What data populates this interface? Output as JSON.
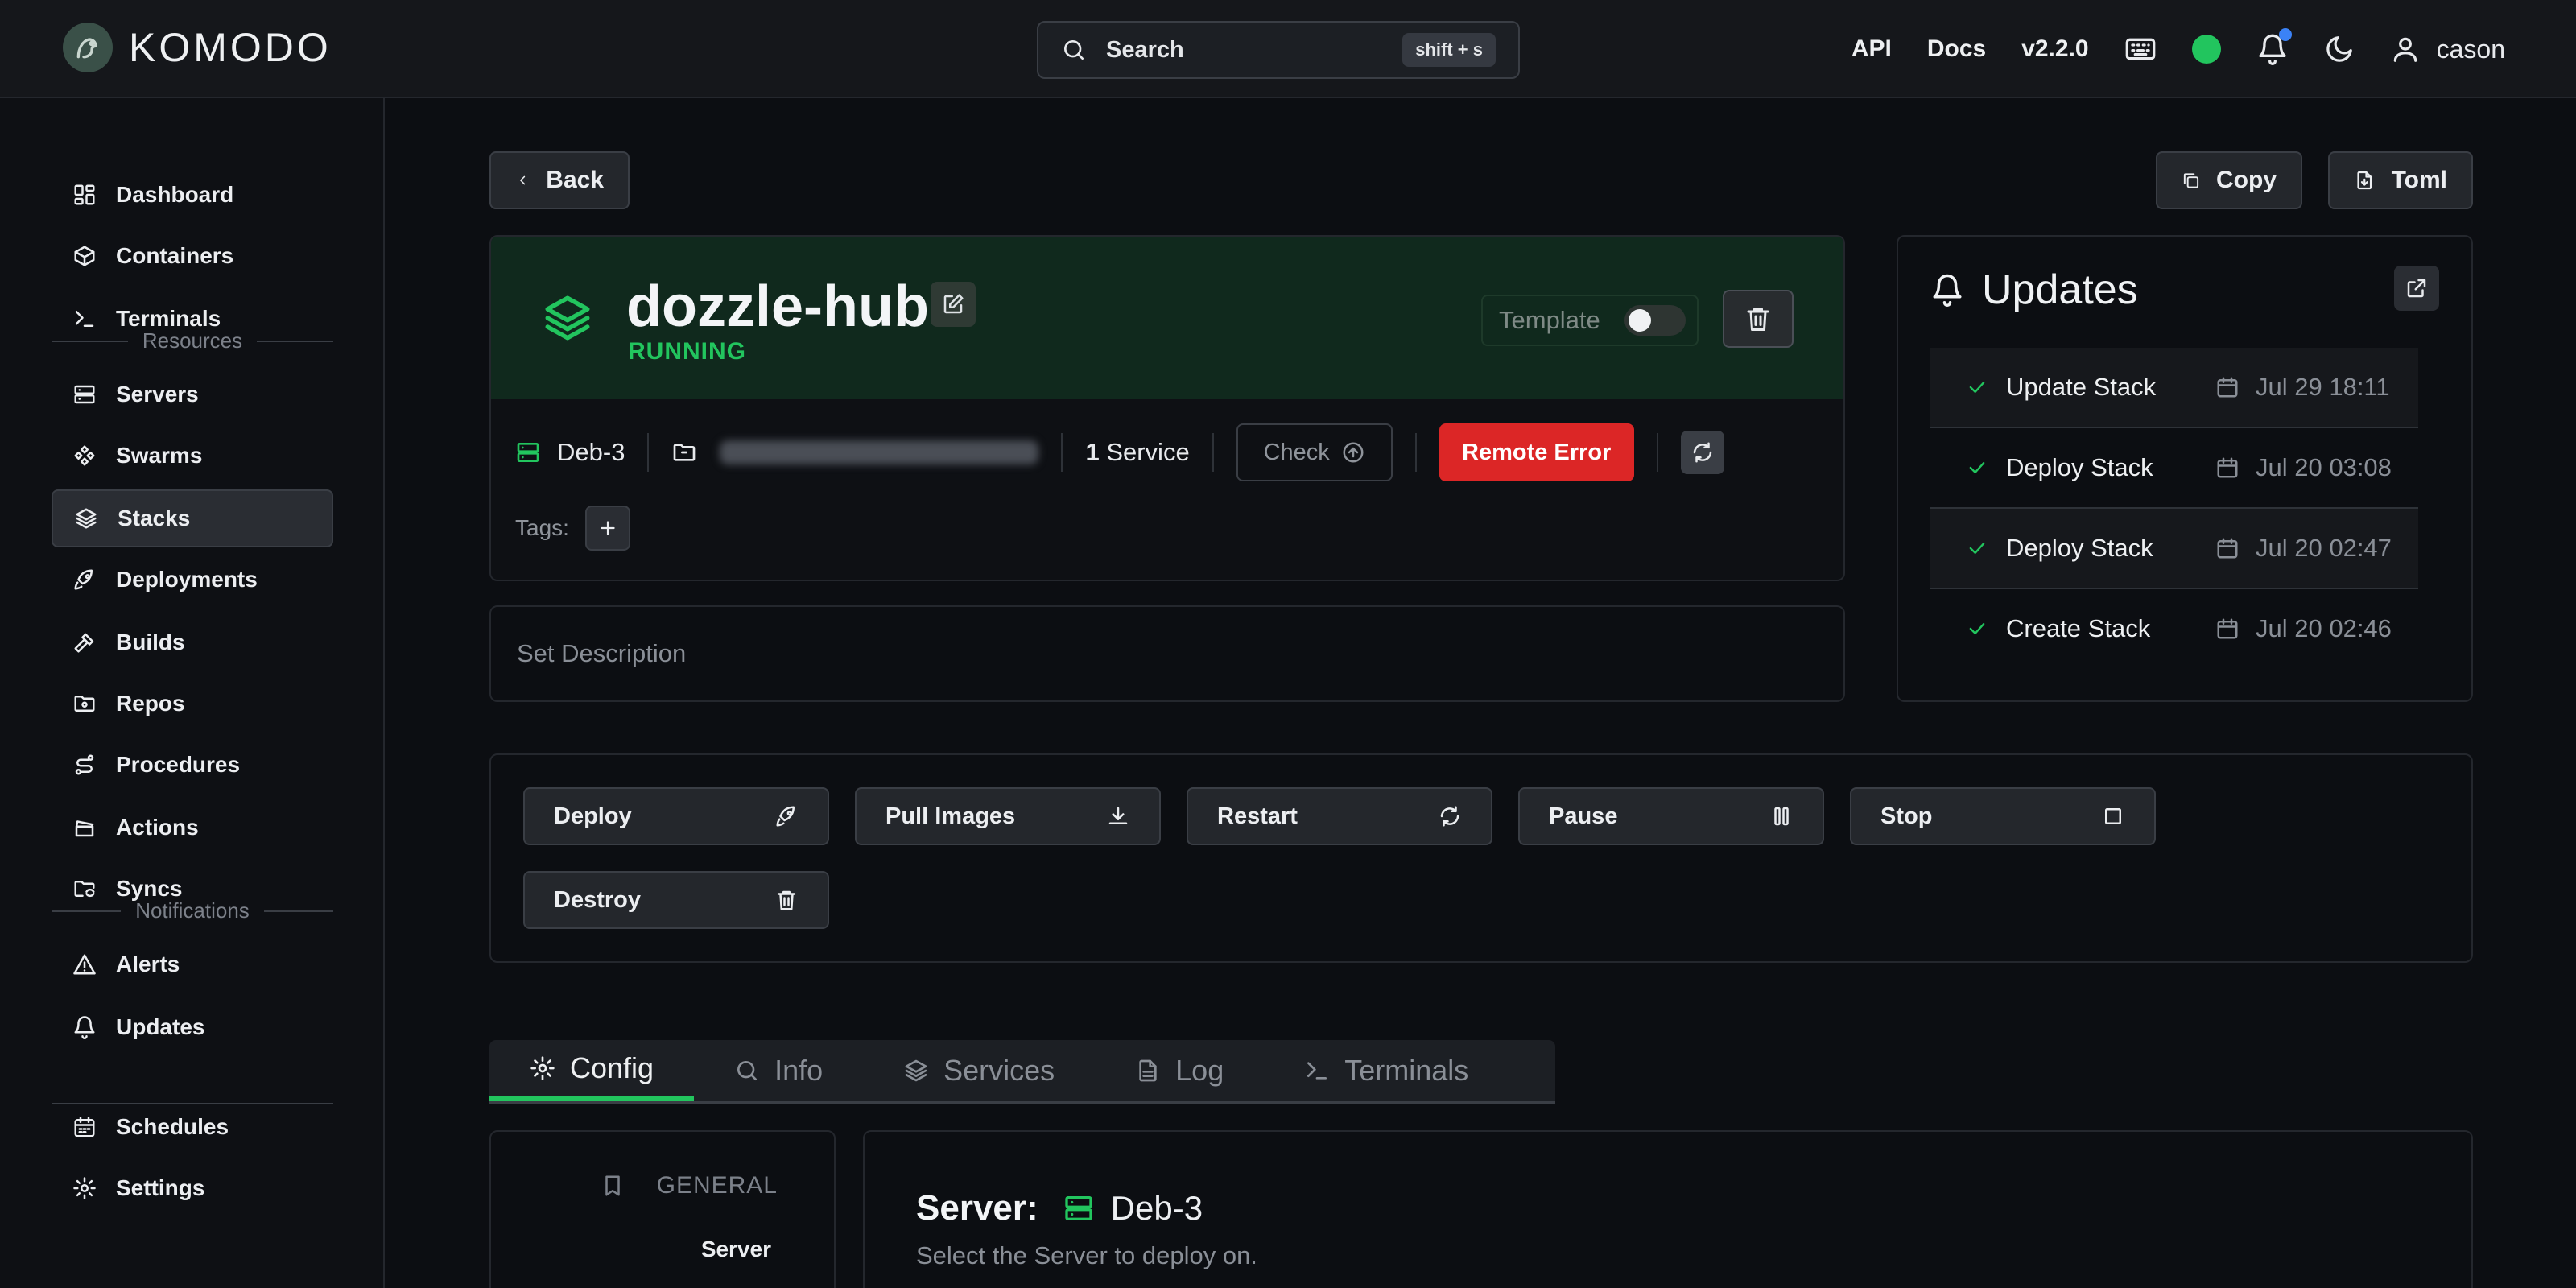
{
  "header": {
    "brand": "KOMODO",
    "search": {
      "label": "Search",
      "shortcut": "shift + s"
    },
    "links": {
      "api": "API",
      "docs": "Docs",
      "version": "v2.2.0"
    },
    "username": "cason"
  },
  "sidebar": {
    "items": [
      {
        "label": "Dashboard",
        "icon": "dashboard-icon"
      },
      {
        "label": "Containers",
        "icon": "box-icon"
      },
      {
        "label": "Terminals",
        "icon": "terminal-icon"
      },
      {
        "label": "Servers",
        "icon": "server-icon"
      },
      {
        "label": "Swarms",
        "icon": "swarm-icon"
      },
      {
        "label": "Stacks",
        "icon": "layers-icon",
        "active": true
      },
      {
        "label": "Deployments",
        "icon": "rocket-icon"
      },
      {
        "label": "Builds",
        "icon": "hammer-icon"
      },
      {
        "label": "Repos",
        "icon": "folder-git-icon"
      },
      {
        "label": "Procedures",
        "icon": "route-icon"
      },
      {
        "label": "Actions",
        "icon": "clapperboard-icon"
      },
      {
        "label": "Syncs",
        "icon": "folder-sync-icon"
      },
      {
        "label": "Alerts",
        "icon": "alert-triangle-icon"
      },
      {
        "label": "Updates",
        "icon": "bell-icon"
      },
      {
        "label": "Schedules",
        "icon": "calendar-icon"
      },
      {
        "label": "Settings",
        "icon": "gear-icon"
      }
    ],
    "sections": {
      "resources": "Resources",
      "notifications": "Notifications"
    }
  },
  "page": {
    "back": "Back",
    "copy": "Copy",
    "toml": "Toml"
  },
  "stack": {
    "name": "dozzle-hub",
    "status": "RUNNING",
    "template_label": "Template",
    "server": "Deb-3",
    "service_count": "1",
    "service_label": "Service",
    "check": "Check",
    "remote_error": "Remote Error",
    "tags_label": "Tags:",
    "description_placeholder": "Set Description"
  },
  "updates": {
    "title": "Updates",
    "rows": [
      {
        "name": "Update Stack",
        "date": "Jul 29 18:11"
      },
      {
        "name": "Deploy Stack",
        "date": "Jul 20 03:08"
      },
      {
        "name": "Deploy Stack",
        "date": "Jul 20 02:47"
      },
      {
        "name": "Create Stack",
        "date": "Jul 20 02:46"
      }
    ]
  },
  "actions": {
    "deploy": "Deploy",
    "pull": "Pull Images",
    "restart": "Restart",
    "pause": "Pause",
    "stop": "Stop",
    "destroy": "Destroy"
  },
  "tabs": [
    {
      "label": "Config",
      "active": true
    },
    {
      "label": "Info"
    },
    {
      "label": "Services"
    },
    {
      "label": "Log"
    },
    {
      "label": "Terminals"
    }
  ],
  "config": {
    "section": "GENERAL",
    "nav_server": "Server",
    "server_label": "Server:",
    "server_value": "Deb-3",
    "server_hint": "Select the Server to deploy on."
  },
  "colors": {
    "accent": "#22c55e",
    "danger": "#dc2626",
    "hero_bg": "#10291d",
    "notification": "#3b82f6"
  }
}
